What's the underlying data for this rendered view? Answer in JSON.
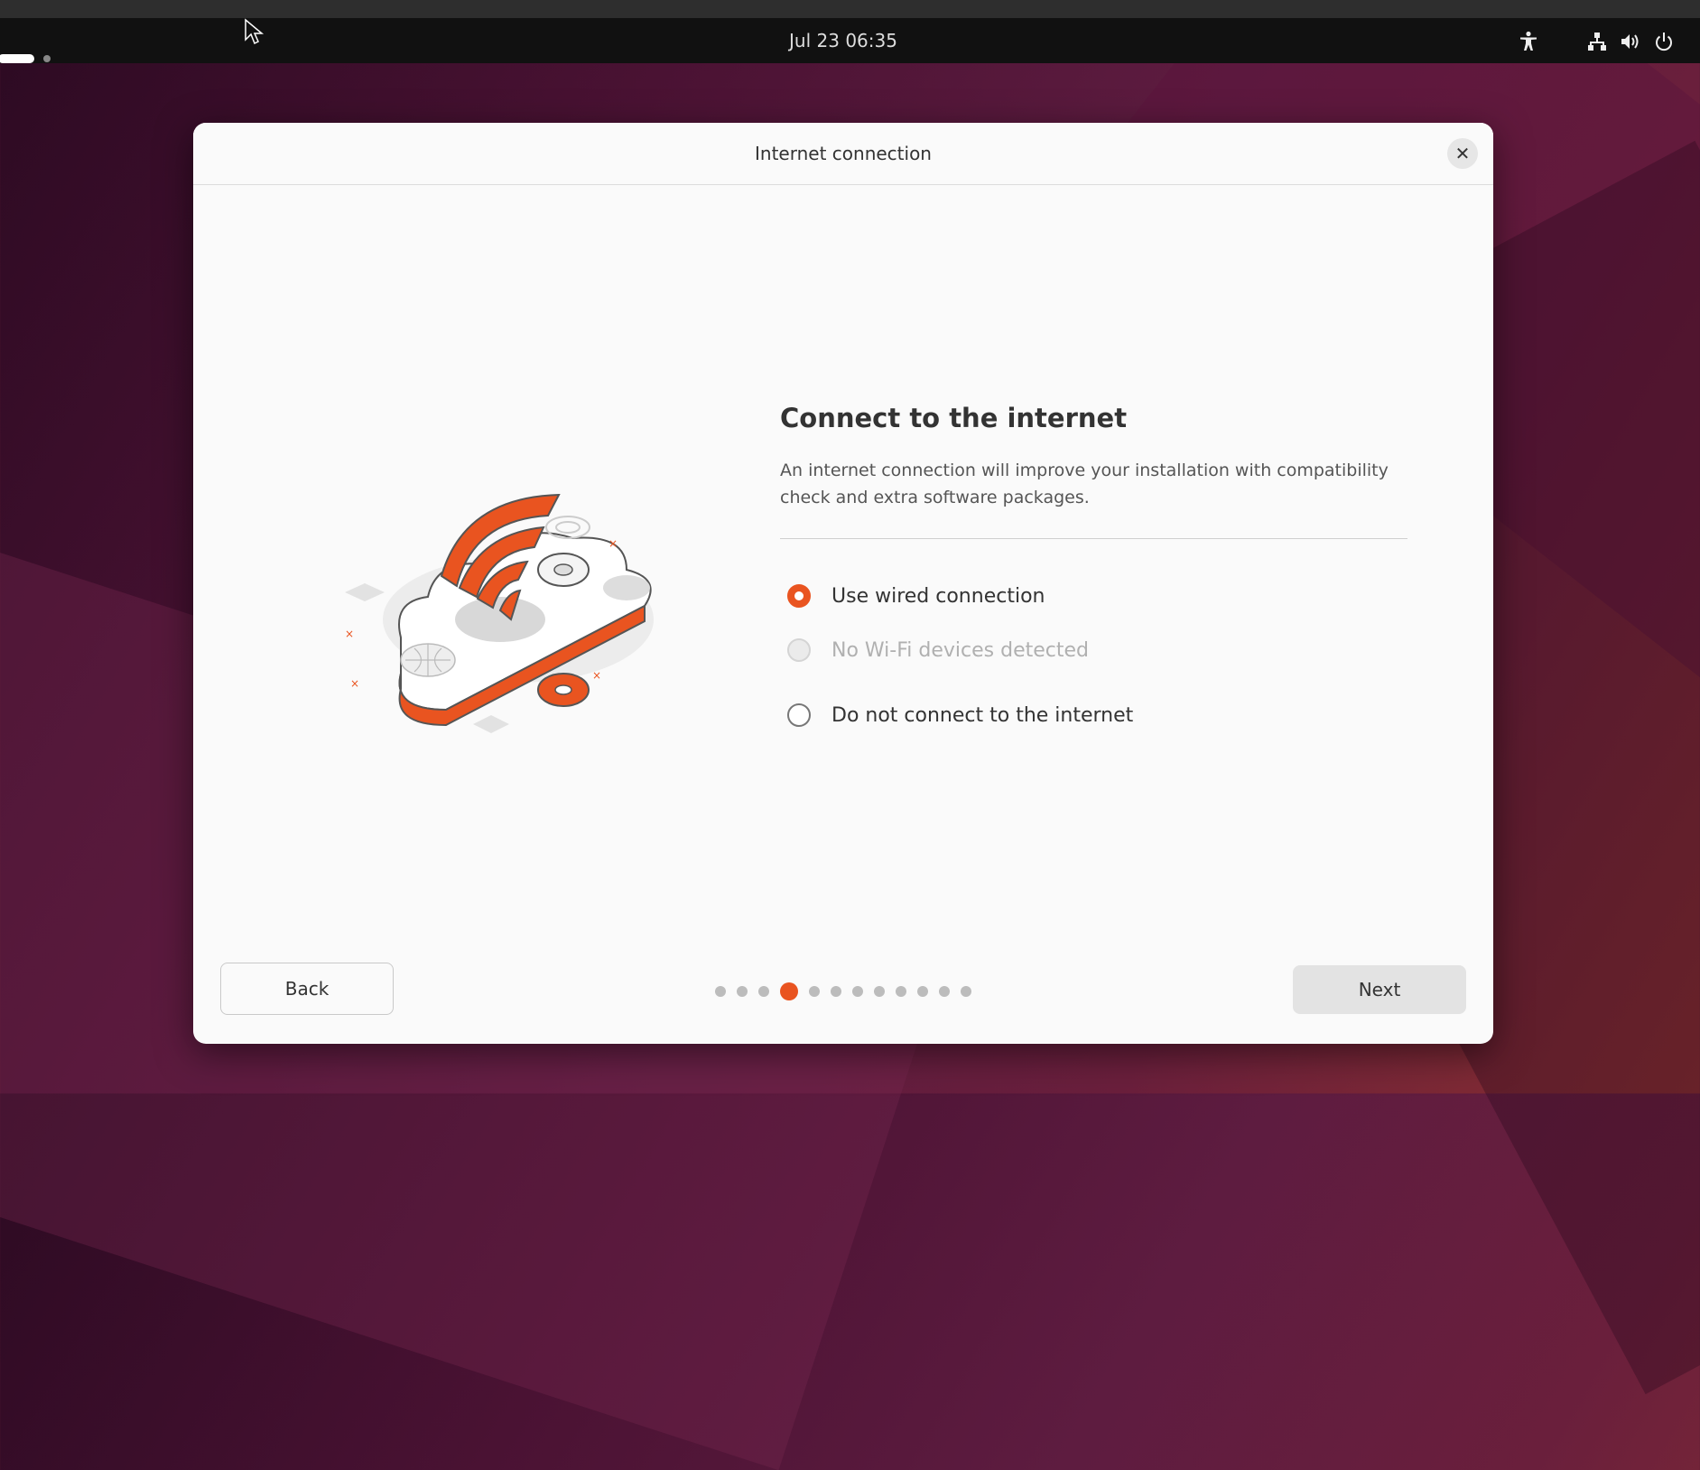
{
  "topbar": {
    "clock": "Jul 23  06:35",
    "icons": [
      "accessibility-icon",
      "network-wired-icon",
      "volume-icon",
      "power-icon"
    ]
  },
  "dialog": {
    "title": "Internet connection",
    "close_icon": "close-icon"
  },
  "content": {
    "heading": "Connect to the internet",
    "description": "An internet connection will improve your installation with compatibility check and extra software packages.",
    "options": [
      {
        "label": "Use wired connection",
        "state": "checked"
      },
      {
        "label": "No Wi-Fi devices detected",
        "state": "disabled"
      },
      {
        "label": "Do not connect to the internet",
        "state": "unchecked"
      }
    ]
  },
  "footer": {
    "back_label": "Back",
    "next_label": "Next",
    "pager": {
      "total": 12,
      "current": 4
    }
  },
  "colors": {
    "accent": "#e95420",
    "dialog_bg": "#fafafa",
    "topbar_bg": "#111111"
  }
}
